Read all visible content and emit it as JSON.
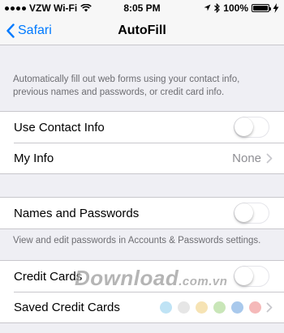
{
  "status_bar": {
    "carrier": "VZW Wi-Fi",
    "time": "8:05 PM",
    "battery_percent": "100%"
  },
  "nav": {
    "back_label": "Safari",
    "title": "AutoFill"
  },
  "intro_text": "Automatically fill out web forms using your contact info, previous names and passwords, or credit card info.",
  "contact_group": {
    "use_contact_info_label": "Use Contact Info",
    "use_contact_info_on": false,
    "my_info_label": "My Info",
    "my_info_value": "None"
  },
  "passwords_group": {
    "label": "Names and Passwords",
    "on": false,
    "footer": "View and edit passwords in Accounts & Passwords settings."
  },
  "cards_group": {
    "credit_cards_label": "Credit Cards",
    "credit_cards_on": false,
    "saved_cards_label": "Saved Credit Cards"
  },
  "watermark": {
    "main": "Download",
    "sub": ".com.vn"
  },
  "colors": {
    "accent": "#007aff",
    "watermark_dots": [
      "#bfe3f5",
      "#e6e6e6",
      "#f6e3b4",
      "#c9e6b8",
      "#a9c9ec",
      "#f5b9b9"
    ]
  },
  "icons": {
    "back": "chevron-left-icon",
    "disclosure": "chevron-right-icon",
    "wifi": "wifi-icon",
    "location": "location-arrow-icon",
    "bluetooth": "bluetooth-icon",
    "battery": "battery-icon",
    "charging": "charging-bolt-icon"
  }
}
